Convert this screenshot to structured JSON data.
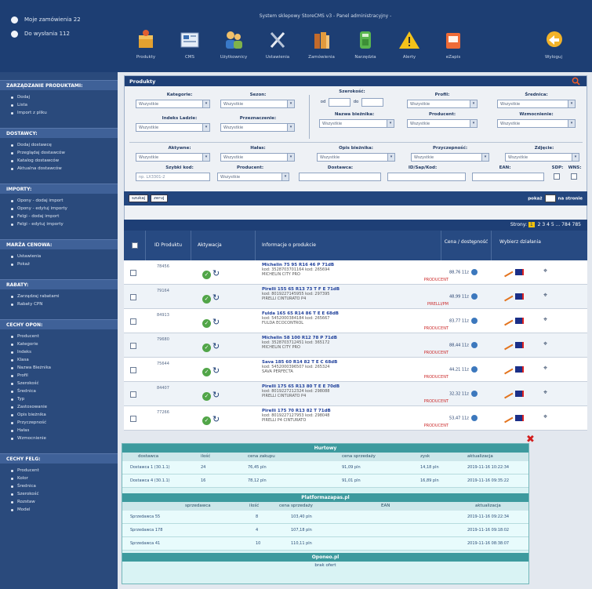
{
  "topbar": {
    "links": [
      "Moje zamówienia 22",
      "Do wysłania 112"
    ],
    "caption": "System sklepowy StoreCMS v3 - Panel administracyjny -",
    "nav": [
      "Produkty",
      "CMS",
      "Użytkownicy",
      "Ustawienia",
      "Zamówienia",
      "Narzędzia",
      "Alerty",
      "eZapis",
      "Wyloguj"
    ]
  },
  "sidebar": {
    "sections": [
      {
        "head": "ZARZĄDZANIE PRODUKTAMI:",
        "items": [
          "Dodaj",
          "Lista",
          "Import z pliku"
        ]
      },
      {
        "head": "DOSTAWCY:",
        "items": [
          "Dodaj dostawcę",
          "Przeglądaj dostawców",
          "Katalog dostawców",
          "Aktualna dostawców"
        ]
      },
      {
        "head": "IMPORTY:",
        "items": [
          "Opony - dodaj import",
          "Opony - edytuj importy",
          "Felgi - dodaj import",
          "Felgi - edytuj importy"
        ]
      },
      {
        "head": "MARŻA CENOWA:",
        "items": [
          "Ustawienia",
          "Pokaż"
        ]
      },
      {
        "head": "RABATY:",
        "items": [
          "Zarządzaj rabatami",
          "Rabaty CPN"
        ]
      },
      {
        "head": "CECHY OPON:",
        "items": [
          "Producent",
          "Kategorie",
          "Indeks",
          "Klasa",
          "Nazwa Bieżnika",
          "Profil",
          "Szerokość",
          "Średnica",
          "Typ",
          "Zastosowanie",
          "Opis bieżnika",
          "Przyczepność",
          "Hałas",
          "Wzmocnienie"
        ]
      },
      {
        "head": "CECHY FELG:",
        "items": [
          "Producent",
          "Kolor",
          "Średnica",
          "Szerokość",
          "Rozstaw",
          "Model"
        ]
      }
    ]
  },
  "panel": {
    "title": "Produkty",
    "filters": {
      "kategorie": {
        "label": "Kategorie:",
        "value": "Wszystkie"
      },
      "sezon": {
        "label": "Sezon:",
        "value": "Wszystkie"
      },
      "szerokosc": {
        "label": "Szerokość:",
        "from": "od",
        "to": "do"
      },
      "profil": {
        "label": "Profil:",
        "value": "Wszystkie"
      },
      "srednica": {
        "label": "Średnica:",
        "value": "Wszystkie"
      },
      "indeks": {
        "label": "Indeks Ladzie:",
        "value": "Wszystkie"
      },
      "przeznaczenie": {
        "label": "Przeznaczenie:",
        "value": "Wszystkie"
      },
      "bieznik": {
        "label": "Nazwa bieżnika:",
        "value": "Wszystkie"
      },
      "producent": {
        "label": "Producent:",
        "value": "Wszystkie"
      },
      "wzmocnienie": {
        "label": "Wzmocnienie:",
        "value": "Wszystkie"
      },
      "aktywne": {
        "label": "Aktywne:",
        "value": "Wszystkie"
      },
      "halas": {
        "label": "Hałas:",
        "value": "Wszystkie"
      },
      "opis": {
        "label": "Opis bieżnika:",
        "value": "Wszystkie"
      },
      "przyczepnosc": {
        "label": "Przyczepność:",
        "value": "Wszystkie"
      },
      "zdjecie": {
        "label": "Zdjęcie:",
        "value": "Wszystkie"
      },
      "szybki": {
        "label": "Szybki kod:",
        "value": "np. LX3301-2"
      },
      "producent2": {
        "label": "Producent:",
        "value": "Wszystkie"
      },
      "dostawca": {
        "label": "Dostawca:",
        "value": ""
      },
      "id": {
        "label": "ID/Sap/Kod:",
        "value": ""
      },
      "ean": {
        "label": "EAN:",
        "value": ""
      },
      "sdp": {
        "label": "SDP:"
      },
      "wns": {
        "label": "WNS:"
      }
    },
    "actions": {
      "btn1": "szukaj",
      "btn2": "zeruj",
      "per_page_label": "pokaż",
      "per_page_suffix": "na stronie"
    },
    "pager": {
      "label": "Strony:",
      "current": "1",
      "rest": "2 3 4 5 ... 784 785"
    }
  },
  "table": {
    "headers": [
      "ID Produktu",
      "Aktywacja",
      "Informacje o produkcie",
      "Cena / dostępność",
      "Wybierz działania"
    ],
    "rows": [
      {
        "id": "78456",
        "title": "Michelin 75 95 R16 46 P 71dB",
        "ean": "kod: 3528703701164 kod: 265694",
        "sub": "MICHELIN CITY PRO",
        "stock": "PRODUCENT",
        "price": "88,76 11z"
      },
      {
        "id": "79164",
        "title": "Pirelli 155 65 R13 73 T F E 71dB",
        "ean": "kod: 8019227145955 kod: 297395",
        "sub": "PIRELLI CINTURATO P4",
        "stock": "PIRELLI/PM",
        "price": "48,99 11z"
      },
      {
        "id": "84913",
        "title": "Fulda 165 65 R14 86 T E E 68dB",
        "ean": "kod: 5452000384184 kod: 265667",
        "sub": "FULDA ECOCONTROL",
        "stock": "PRODUCENT",
        "price": "83,77 11z"
      },
      {
        "id": "79680",
        "title": "Michelin 58 100 R12 78 P 71dB",
        "ean": "kod: 3528703712451 kod: 365172",
        "sub": "MICHELIN CITY PRO",
        "stock": "PRODUCENT",
        "price": "88,44 11z"
      },
      {
        "id": "75644",
        "title": "Sava 185 60 R14 82 T E C 68dB",
        "ean": "kod: 5452000396507 kod: 265324",
        "sub": "SAVA PERFECTA",
        "stock": "PRODUCENT",
        "price": "44,21 11z"
      },
      {
        "id": "84407",
        "title": "Pirelli 175 65 R13 80 T E E 70dB",
        "ean": "kod: 8019227212324 kod: 298088",
        "sub": "PIRELLI CINTURATO P4",
        "stock": "PRODUCENT",
        "price": "32,32 11z"
      },
      {
        "id": "77266",
        "title": "Pirelli 175 70 R13 82 T 71dB",
        "ean": "kod: 8019227127953 kod: 298048",
        "sub": "PIRELLI P4 CINTURATO",
        "stock": "PRODUCENT",
        "price": "53,47 11z"
      }
    ]
  },
  "overlay": {
    "title1": "Hurtowy",
    "cols1": [
      "dostawca",
      "ilość",
      "cena zakupu",
      "cena sprzedaży",
      "zysk",
      "aktualizacja"
    ],
    "rows1": [
      [
        "Dostawca 1 (30.1.1)",
        "24",
        "76,45 pln",
        "91,09 pln",
        "14,18 pln",
        "2019-11-16 10:22:34"
      ],
      [
        "Dostawca 4 (30.1.1)",
        "16",
        "78,12 pln",
        "91,01 pln",
        "16,89 pln",
        "2019-11-16 09:35:22"
      ]
    ],
    "title2": "Platformazapas.pl",
    "cols2": [
      "sprzedawca",
      "ilość",
      "cena sprzedaży",
      "EAN",
      "aktualizacja"
    ],
    "rows2": [
      [
        "Sprzedawca 55",
        "8",
        "103,40 pln",
        "",
        "2019-11-16 09:22:34"
      ],
      [
        "Sprzedawca 178",
        "4",
        "107,18 pln",
        "",
        "2019-11-16 09:18:02"
      ],
      [
        "Sprzedawca 41",
        "10",
        "110,11 pln",
        "",
        "2019-11-16 08:38:07"
      ]
    ],
    "title3": "Oponeo.pl",
    "last": "brak ofert"
  }
}
